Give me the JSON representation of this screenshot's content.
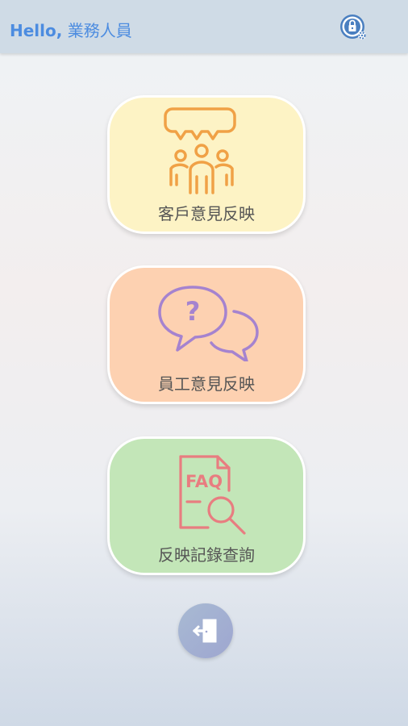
{
  "header": {
    "greeting_hello": "Hello,",
    "greeting_name": " 業務人員",
    "settings_icon": "lock-gear-icon"
  },
  "menu": {
    "customer_feedback_label": "客戶意見反映",
    "employee_feedback_label": "員工意見反映",
    "records_query_label": "反映記錄查詢",
    "records_icon_text": "FAQ"
  },
  "colors": {
    "header_bg": "#cfdbe6",
    "greeting_text": "#4c8ce0",
    "tile_customer": "#fdf3c5",
    "tile_employee": "#fdd1b1",
    "tile_records": "#c3e6b8",
    "icon_customer": "#f0a146",
    "icon_employee": "#a583cf",
    "icon_records": "#e87d80"
  },
  "logout": {
    "icon": "logout-door-icon"
  }
}
